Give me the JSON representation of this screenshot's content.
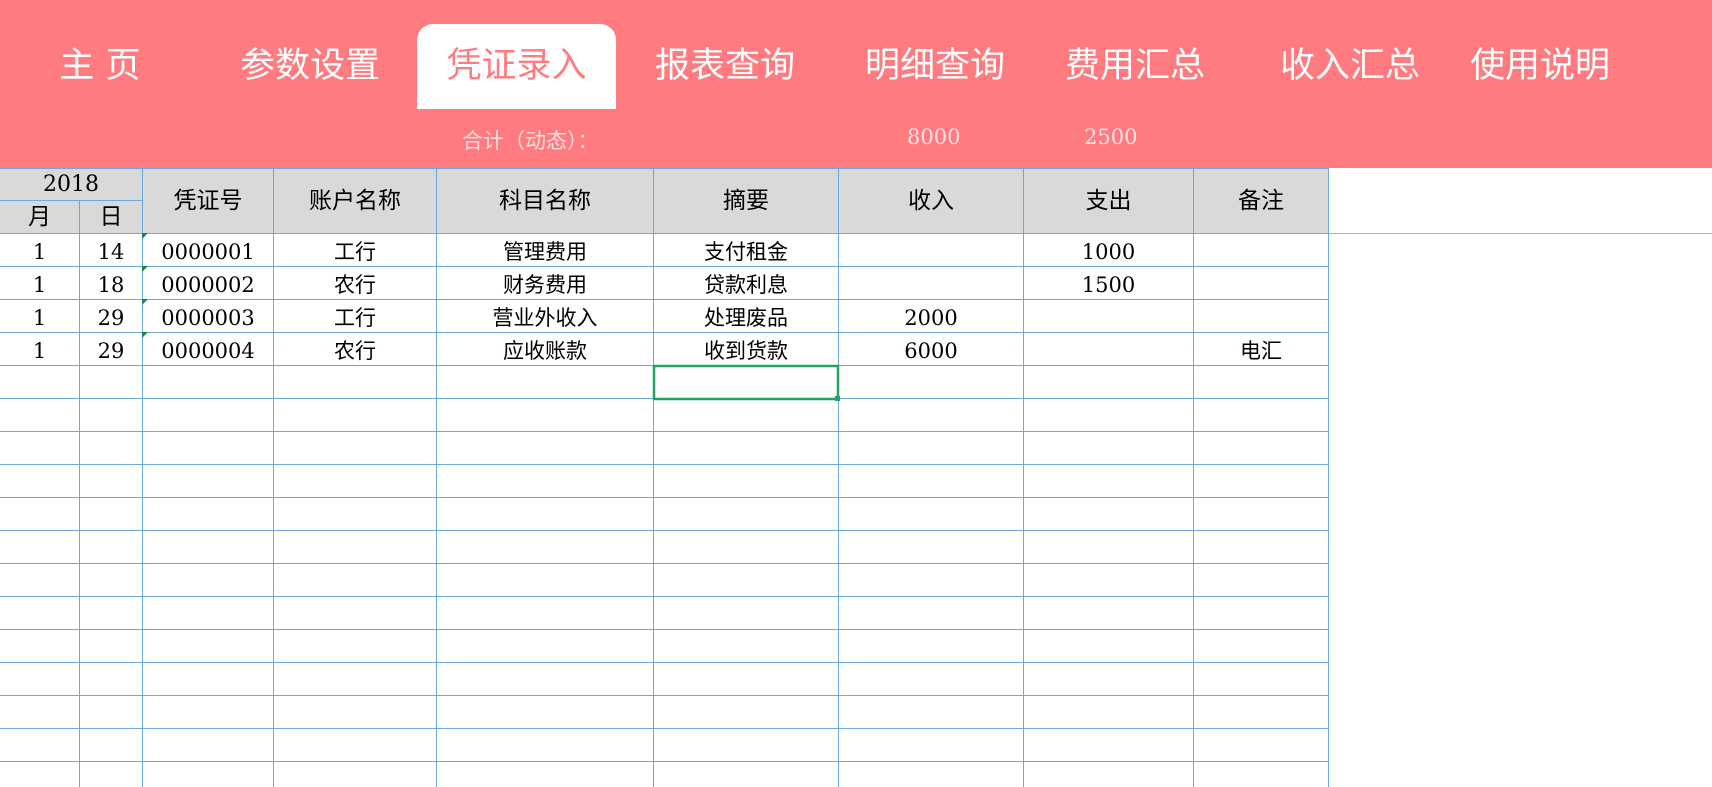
{
  "nav": {
    "tabs": [
      {
        "label": "主  页",
        "active": false
      },
      {
        "label": "参数设置",
        "active": false
      },
      {
        "label": "凭证录入",
        "active": true
      },
      {
        "label": "报表查询",
        "active": false
      },
      {
        "label": "明细查询",
        "active": false
      },
      {
        "label": "费用汇总",
        "active": false
      },
      {
        "label": "收入汇总",
        "active": false
      },
      {
        "label": "使用说明",
        "active": false
      }
    ]
  },
  "summary": {
    "label": "合计（动态）：",
    "income_total": "8000",
    "expense_total": "2500"
  },
  "table": {
    "year": "2018",
    "month_header": "月",
    "day_header": "日",
    "headers": [
      "凭证号",
      "账户名称",
      "科目名称",
      "摘要",
      "收入",
      "支出",
      "备注"
    ],
    "rows": [
      {
        "month": "1",
        "day": "14",
        "voucher": "0000001",
        "account": "工行",
        "subject": "管理费用",
        "summary": "支付租金",
        "income": "",
        "expense": "1000",
        "note": ""
      },
      {
        "month": "1",
        "day": "18",
        "voucher": "0000002",
        "account": "农行",
        "subject": "财务费用",
        "summary": "贷款利息",
        "income": "",
        "expense": "1500",
        "note": ""
      },
      {
        "month": "1",
        "day": "29",
        "voucher": "0000003",
        "account": "工行",
        "subject": "营业外收入",
        "summary": "处理废品",
        "income": "2000",
        "expense": "",
        "note": ""
      },
      {
        "month": "1",
        "day": "29",
        "voucher": "0000004",
        "account": "农行",
        "subject": "应收账款",
        "summary": "收到货款",
        "income": "6000",
        "expense": "",
        "note": "电汇"
      }
    ]
  },
  "colors": {
    "header_bg": "#ff7b80",
    "grid_line": "#6fa8dc",
    "selection": "#21a366",
    "column_header_bg": "#d9d9d9"
  }
}
